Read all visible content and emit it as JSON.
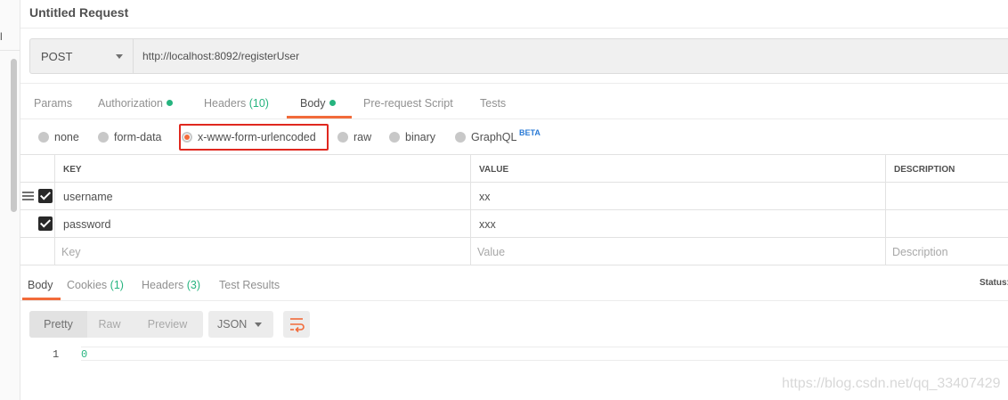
{
  "request": {
    "title": "Untitled Request",
    "method": "POST",
    "url": "http://localhost:8092/registerUser"
  },
  "tabs": [
    {
      "label": "Params"
    },
    {
      "label": "Authorization"
    },
    {
      "label": "Headers",
      "count": "(10)"
    },
    {
      "label": "Body"
    },
    {
      "label": "Pre-request Script"
    },
    {
      "label": "Tests"
    }
  ],
  "body_types": {
    "options": [
      "none",
      "form-data",
      "x-www-form-urlencoded",
      "raw",
      "binary",
      "GraphQL"
    ],
    "selected": "x-www-form-urlencoded",
    "beta_label": "BETA"
  },
  "params_table": {
    "headers": {
      "key": "KEY",
      "value": "VALUE",
      "description": "DESCRIPTION"
    },
    "rows": [
      {
        "key": "username",
        "value": "xx",
        "description": "",
        "checked": true
      },
      {
        "key": "password",
        "value": "xxx",
        "description": "",
        "checked": true
      }
    ],
    "placeholders": {
      "key": "Key",
      "value": "Value",
      "description": "Description"
    }
  },
  "response": {
    "tabs": [
      {
        "label": "Body"
      },
      {
        "label": "Cookies",
        "count": "(1)"
      },
      {
        "label": "Headers",
        "count": "(3)"
      },
      {
        "label": "Test Results"
      }
    ],
    "status_label": "Status:",
    "view_modes": [
      "Pretty",
      "Raw",
      "Preview"
    ],
    "format": "JSON",
    "code": {
      "line": "1",
      "value": "0"
    }
  },
  "watermark": "https://blog.csdn.net/qq_33407429",
  "colors": {
    "accent": "#f26b3a",
    "success": "#26b47f",
    "highlight": "#e0281f",
    "beta": "#2b7bd6"
  },
  "icons": [
    "hamburger-icon",
    "chevron-down-icon",
    "wrap-text-icon",
    "checkbox-checked-icon"
  ]
}
